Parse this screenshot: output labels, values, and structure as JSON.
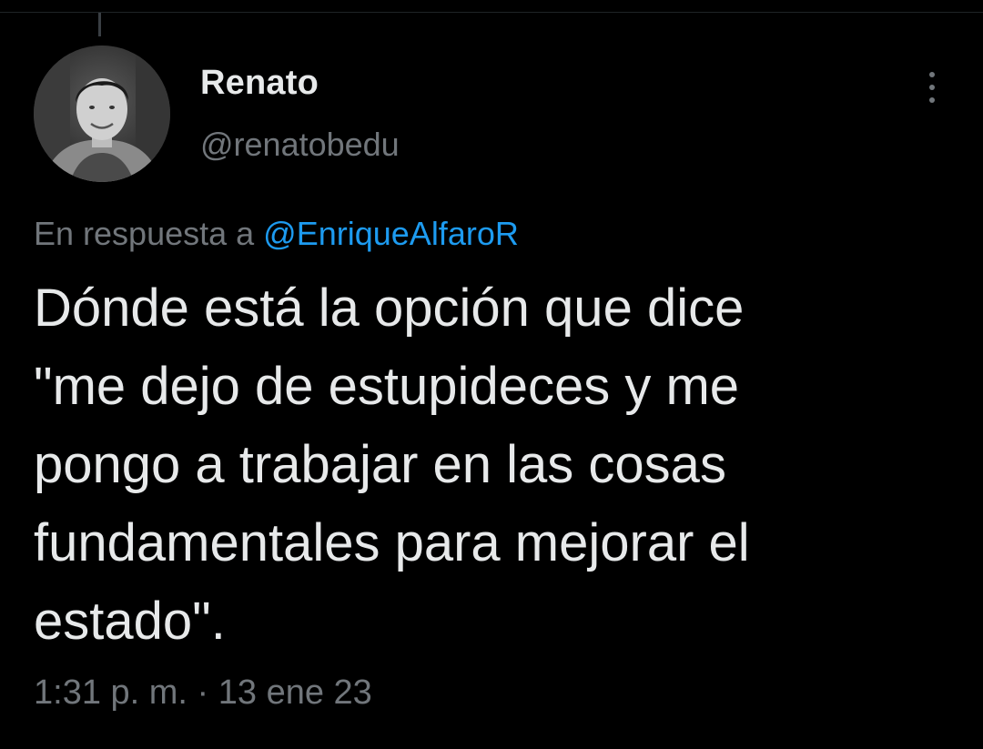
{
  "tweet": {
    "author": {
      "display_name": "Renato",
      "handle": "@renatobedu",
      "avatar_icon": "profile-photo"
    },
    "reply_to": {
      "prefix": "En respuesta a",
      "mention": "@EnriqueAlfaroR"
    },
    "text": "Dónde está la opción que dice\n\"me dejo de estupideces y me\npongo a trabajar en las cosas\nfundamentales para mejorar el\nestado\".",
    "time": "1:31 p. m.",
    "separator": "·",
    "date": "13 ene 23",
    "more_icon": "more-vertical-icon"
  },
  "colors": {
    "background": "#000000",
    "primary_text": "#e7e9ea",
    "secondary_text": "#71767b",
    "link": "#1d9bf0"
  }
}
